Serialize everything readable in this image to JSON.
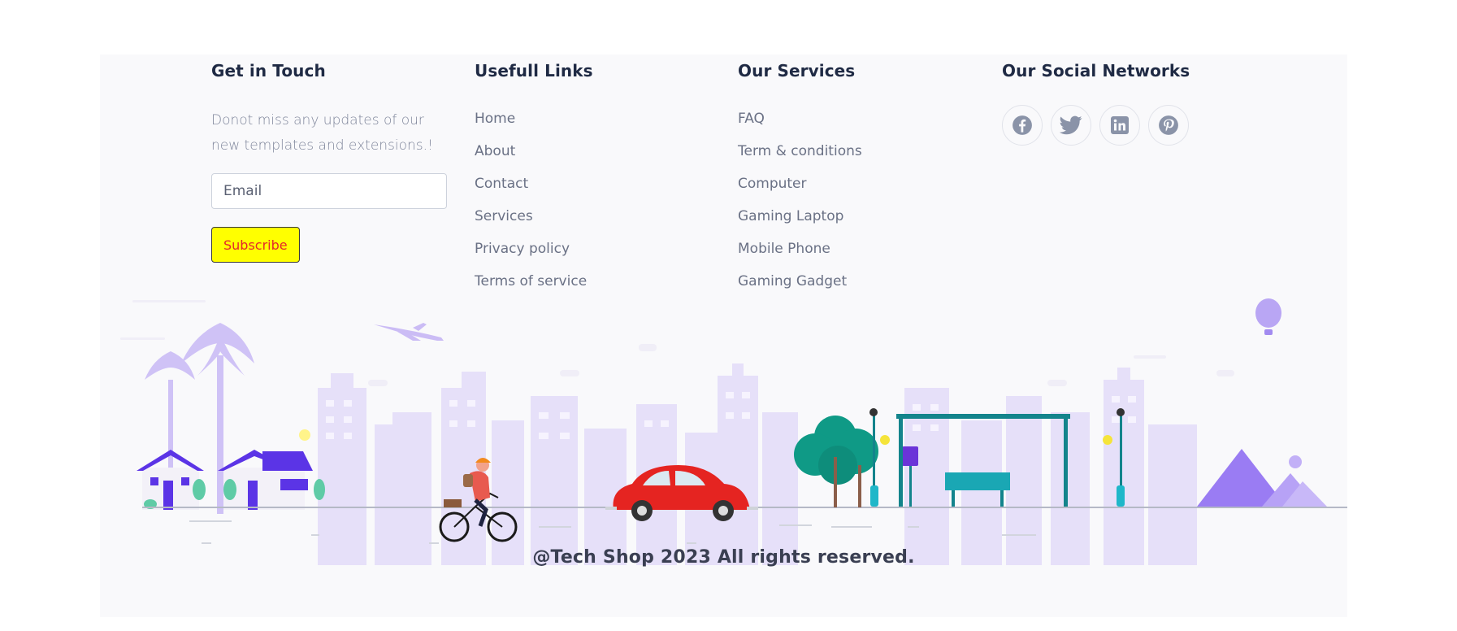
{
  "footer": {
    "contact": {
      "title": "Get in Touch",
      "text": "Donot miss any updates of our new templates and extensions.!",
      "email_placeholder": "Email",
      "subscribe_label": "Subscribe"
    },
    "useful_links": {
      "title": "Usefull Links",
      "items": [
        "Home",
        "About",
        "Contact",
        "Services",
        "Privacy policy",
        "Terms of service"
      ]
    },
    "services": {
      "title": "Our Services",
      "items": [
        "FAQ",
        "Term & conditions",
        "Computer",
        "Gaming Laptop",
        "Mobile Phone",
        "Gaming Gadget"
      ]
    },
    "social": {
      "title": "Our Social Networks",
      "items": [
        {
          "name": "facebook",
          "icon": "facebook-icon"
        },
        {
          "name": "twitter",
          "icon": "twitter-icon"
        },
        {
          "name": "linkedin",
          "icon": "linkedin-icon"
        },
        {
          "name": "pinterest",
          "icon": "pinterest-icon"
        }
      ]
    },
    "copyright": "@Tech Shop 2023 All rights reserved.",
    "colors": {
      "heading": "#1f2a44",
      "link": "#6a7185",
      "subscribe_bg": "#ffff00",
      "subscribe_text": "#e4262c",
      "icon": "#8a93a8",
      "skyline": "#e4def8"
    }
  }
}
